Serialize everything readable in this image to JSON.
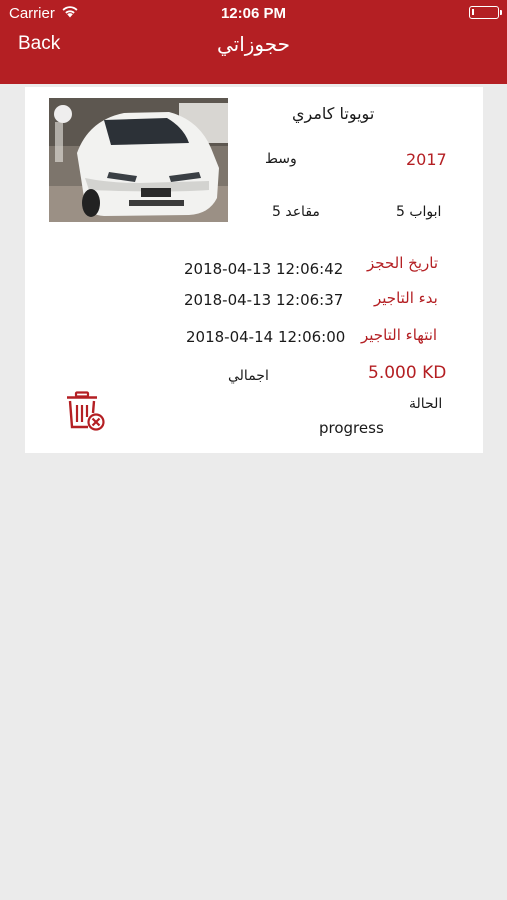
{
  "status_bar": {
    "carrier": "Carrier",
    "time": "12:06 PM"
  },
  "nav": {
    "back_label": "Back",
    "title": "حجوزاتي"
  },
  "booking": {
    "car_name": "تويوتا كامري",
    "year": "2017",
    "category": "وسط",
    "doors": "5 ابواب",
    "seats": "5 مقاعد",
    "booking_date_label": "تاريخ الحجز",
    "booking_date": "2018-04-13 12:06:42",
    "rent_start_label": "بدء التاجير",
    "rent_start": "2018-04-13 12:06:37",
    "rent_end_label": "انتهاء التاجير",
    "rent_end": "2018-04-14 12:06:00",
    "total_value": "5.000 KD",
    "total_label": "اجمالي",
    "status_label": "الحالة",
    "status_value": "progress"
  },
  "icons": {
    "wifi": "wifi-icon",
    "battery": "battery-icon",
    "car_photo": "car-photo",
    "delete": "trash-delete-icon"
  },
  "colors": {
    "accent": "#b41f23",
    "background": "#ebebeb",
    "card": "#ffffff"
  }
}
